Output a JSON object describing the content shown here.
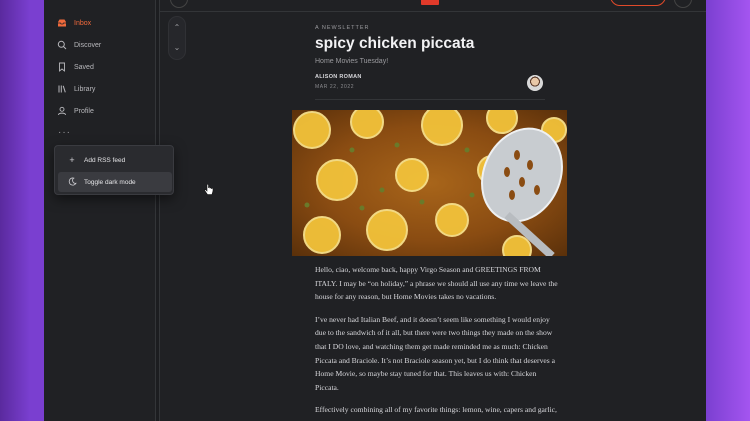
{
  "sidebar": {
    "items": [
      {
        "label": "Inbox",
        "icon": "inbox-icon",
        "active": true
      },
      {
        "label": "Discover",
        "icon": "search-icon"
      },
      {
        "label": "Saved",
        "icon": "bookmark-icon"
      },
      {
        "label": "Library",
        "icon": "library-icon"
      },
      {
        "label": "Profile",
        "icon": "profile-icon"
      }
    ],
    "more": "···"
  },
  "menu": {
    "add_rss": "Add RSS feed",
    "toggle_dark": "Toggle dark mode"
  },
  "pager": {
    "up": "⌃",
    "down": "⌄"
  },
  "article": {
    "eyebrow": "A NEWSLETTER",
    "title": "spicy chicken piccata",
    "subtitle": "Home Movies Tuesday!",
    "author": "ALISON ROMAN",
    "date": "MAR 22, 2022",
    "paragraphs": [
      "Hello, ciao, welcome back, happy Virgo Season and GREETINGS FROM ITALY. I may be “on holiday,” a phrase we should all use any time we leave the house for any reason, but Home Movies takes no vacations.",
      "I’ve never had Italian Beef, and it doesn’t seem like something I would enjoy due to the sandwich of it all, but there were two things they made on the show that I DO love, and watching them get made reminded me as much: Chicken Piccata and Braciole. It’s not Braciole season yet, but I do think that deserves a Home Movie, so maybe stay tuned for that. This leaves us with: Chicken Piccata.",
      "Effectively combining all of my favorite things: lemon, wine, capers and garlic, and using what I consider to be a completely underrated"
    ]
  },
  "colors": {
    "accent": "#f06a3c",
    "background": "#202124"
  }
}
